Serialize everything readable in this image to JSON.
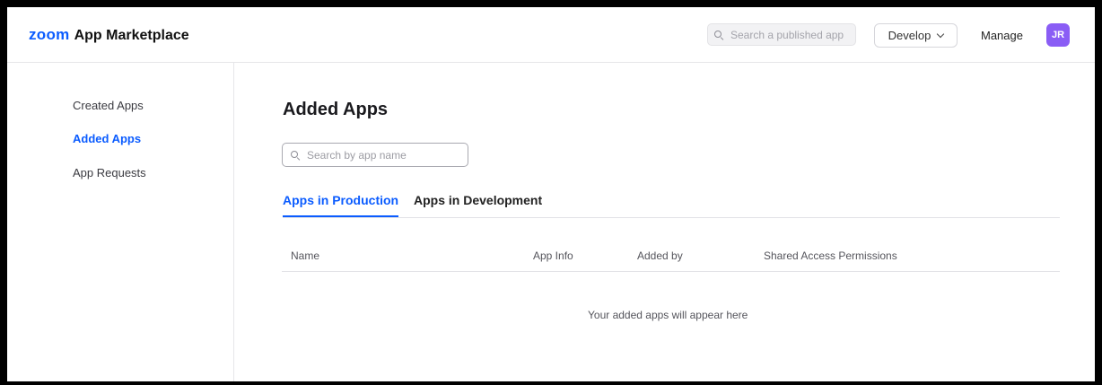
{
  "header": {
    "logo": "zoom",
    "title": "App Marketplace",
    "search_placeholder": "Search a published app",
    "develop_label": "Develop",
    "manage_label": "Manage",
    "avatar_initials": "JR",
    "avatar_color": "#8a5df5",
    "accent_color": "#0b5cff"
  },
  "sidebar": {
    "items": [
      {
        "label": "Created Apps",
        "active": false
      },
      {
        "label": "Added Apps",
        "active": true
      },
      {
        "label": "App Requests",
        "active": false
      }
    ]
  },
  "main": {
    "title": "Added Apps",
    "search_placeholder": "Search by app name",
    "tabs": [
      {
        "label": "Apps in Production",
        "active": true
      },
      {
        "label": "Apps in Development",
        "active": false
      }
    ],
    "table": {
      "columns": [
        "Name",
        "App Info",
        "Added by",
        "Shared Access Permissions"
      ],
      "rows": [],
      "empty_message": "Your added apps will appear here"
    }
  }
}
